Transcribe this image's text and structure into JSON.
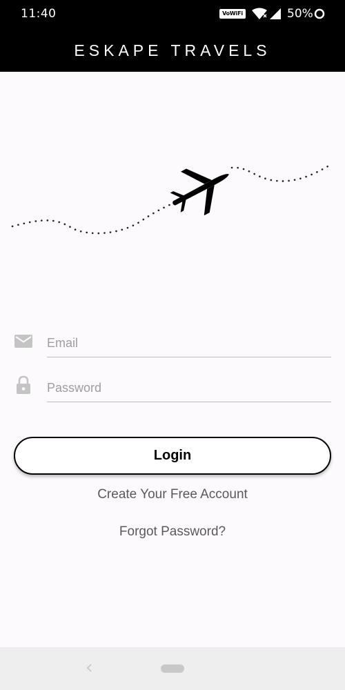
{
  "status_bar": {
    "time": "11:40",
    "vowifi_label": "VoWiFi",
    "battery_percent": "50%",
    "icons": [
      "vowifi-badge",
      "wifi-icon",
      "signal-icon",
      "battery-icon"
    ]
  },
  "app_bar": {
    "title": "ESKAPE TRAVELS"
  },
  "hero": {
    "icon": "airplane-icon"
  },
  "form": {
    "email": {
      "icon": "mail-icon",
      "placeholder": "Email",
      "value": ""
    },
    "password": {
      "icon": "lock-icon",
      "placeholder": "Password",
      "value": ""
    },
    "login_label": "Login",
    "create_account_label": "Create Your Free Account",
    "forgot_password_label": "Forgot Password?"
  },
  "nav_bar": {
    "icons": [
      "back-icon",
      "home-pill"
    ]
  },
  "colors": {
    "header_bg": "#000000",
    "page_bg": "#fcfafc",
    "accent": "#000000",
    "link_text": "#5a5a5a",
    "nav_bg": "#efeeef"
  }
}
